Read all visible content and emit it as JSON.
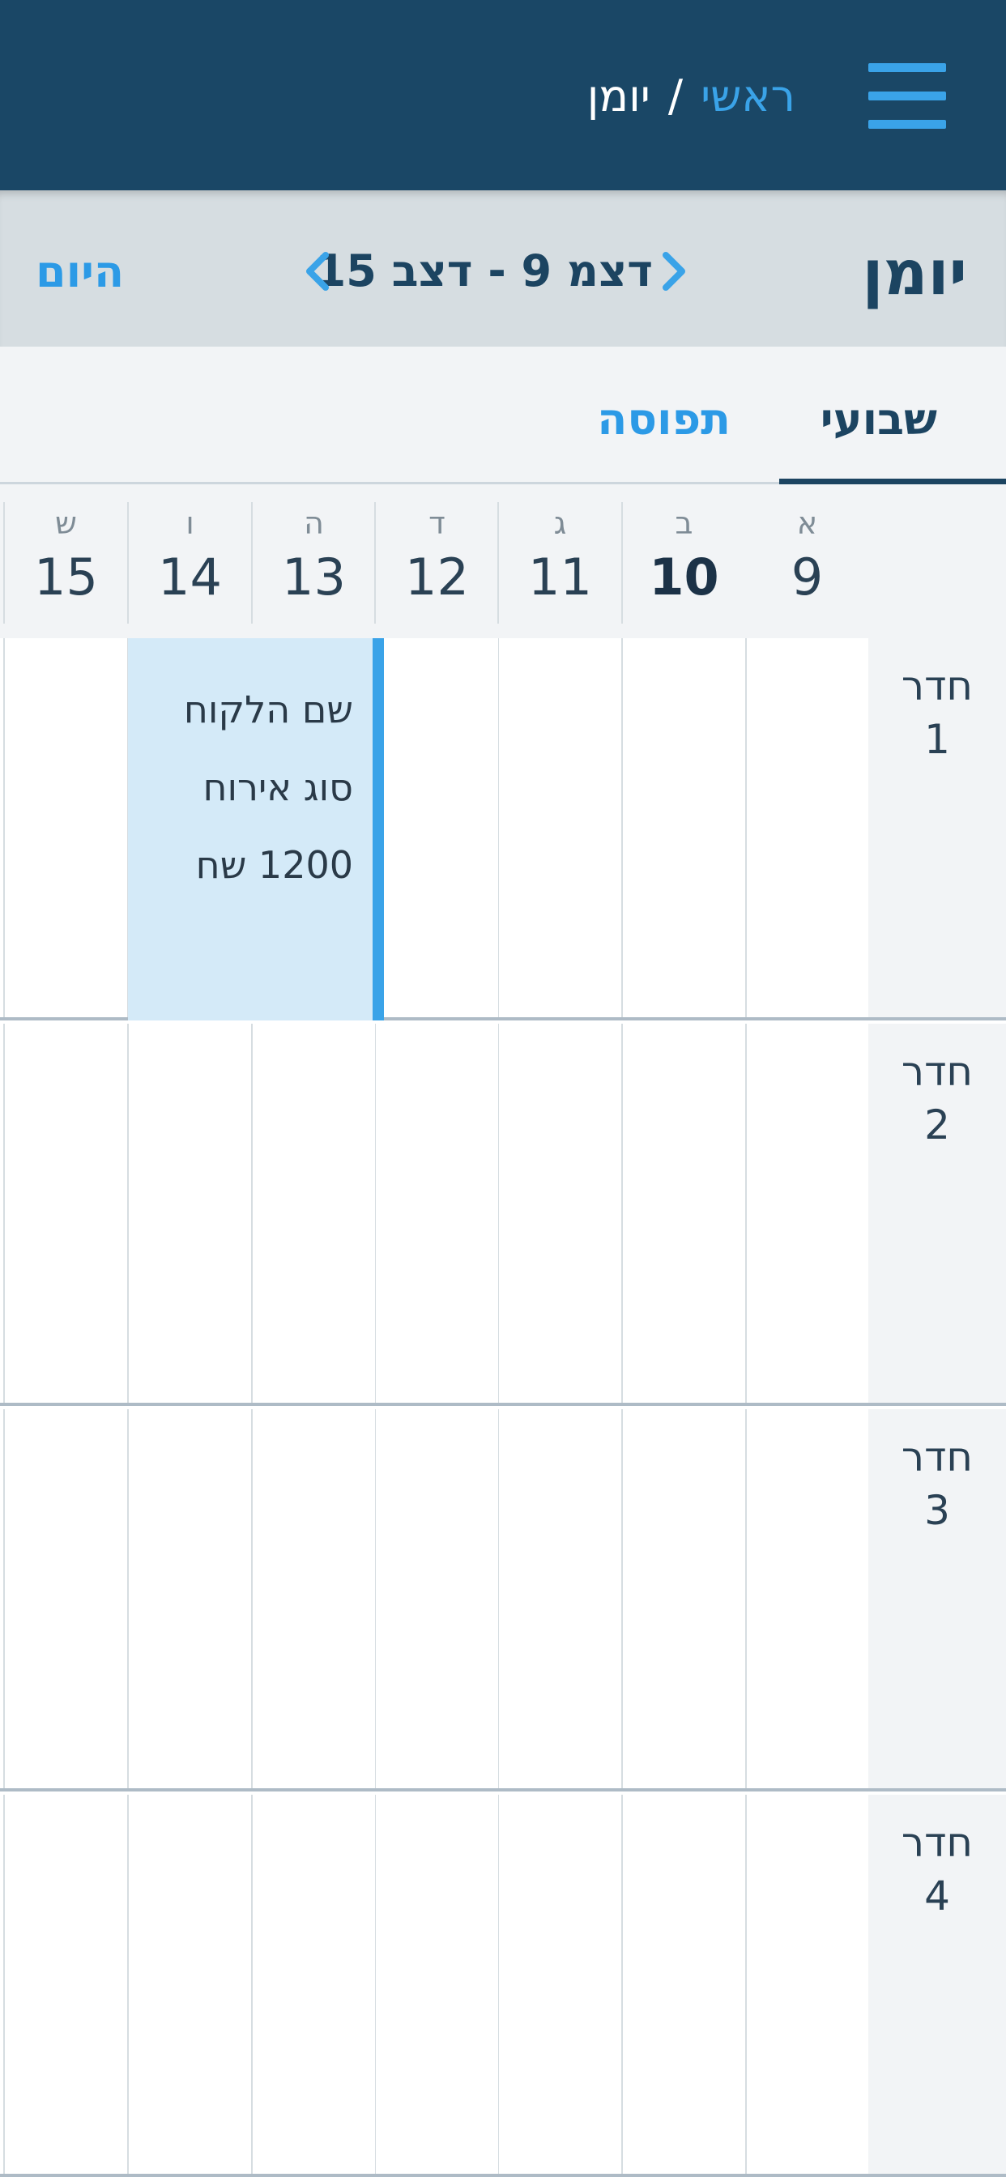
{
  "header": {
    "breadcrumb_home": "ראשי",
    "breadcrumb_separator": "/",
    "breadcrumb_current": "יומן"
  },
  "toolbar": {
    "title": "יומן",
    "date_range": "דצמ 9 - דצב 15",
    "today_label": "היום"
  },
  "tabs": [
    {
      "label": "שבועי",
      "active": true
    },
    {
      "label": "תפוסה",
      "active": false
    }
  ],
  "days": [
    {
      "letter": "א",
      "number": "9",
      "is_today": false
    },
    {
      "letter": "ב",
      "number": "10",
      "is_today": true
    },
    {
      "letter": "ג",
      "number": "11",
      "is_today": false
    },
    {
      "letter": "ד",
      "number": "12",
      "is_today": false
    },
    {
      "letter": "ה",
      "number": "13",
      "is_today": false
    },
    {
      "letter": "ו",
      "number": "14",
      "is_today": false
    },
    {
      "letter": "ש",
      "number": "15",
      "is_today": false
    }
  ],
  "rooms": [
    {
      "word": "חדר",
      "number": "1"
    },
    {
      "word": "חדר",
      "number": "2"
    },
    {
      "word": "חדר",
      "number": "3"
    },
    {
      "word": "חדר",
      "number": "4"
    }
  ],
  "booking": {
    "customer": "שם הלקוח",
    "type": "סוג אירוח",
    "price": "1200 שח"
  },
  "colors": {
    "navbar": "#1a4766",
    "accent": "#3aa3e8",
    "title": "#1c4461",
    "booking_bg": "#d4eaf8"
  }
}
